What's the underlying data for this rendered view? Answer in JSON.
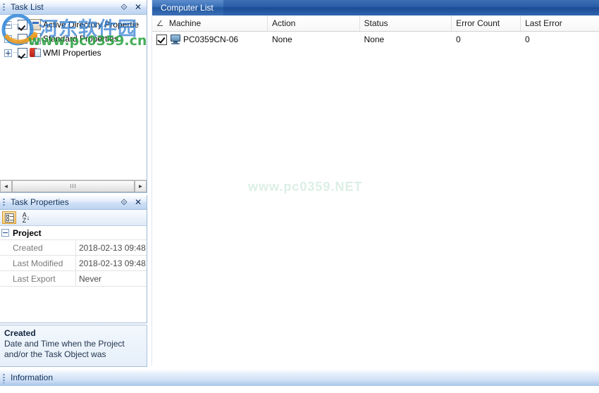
{
  "task_list": {
    "title": "Task List",
    "pin_icon": "pin-icon",
    "close_icon": "close-icon",
    "pin_glyph": "⟐",
    "close_glyph": "✕",
    "items": [
      {
        "label": "Active Directory Propertie",
        "checked": true,
        "expander": "minus",
        "icon": "active-directory-icon"
      },
      {
        "label": "Standard Properties",
        "checked": true,
        "expander": "plus",
        "icon": "standard-properties-icon"
      },
      {
        "label": "WMI Properties",
        "checked": true,
        "expander": "plus",
        "icon": "wmi-properties-icon"
      }
    ],
    "scrollbar": {
      "left_arrow": "◄",
      "right_arrow": "►",
      "thumb_grip": "III"
    }
  },
  "task_properties": {
    "title": "Task Properties",
    "pin_glyph": "⟐",
    "close_glyph": "✕",
    "toolbar": {
      "categorized_label": "Categorized",
      "alphabetical_label": "Alphabetical",
      "az_top": "A",
      "az_bottom": "Z",
      "az_arrow": "↓"
    },
    "category": "Project",
    "rows": [
      {
        "name": "Created",
        "value": "2018-02-13 09:48"
      },
      {
        "name": "Last Modified",
        "value": "2018-02-13 09:48"
      },
      {
        "name": "Last Export",
        "value": "Never"
      }
    ],
    "help": {
      "title": "Created",
      "body": "Date and Time when the Project and/or the Task Object was"
    }
  },
  "information_bar": {
    "title": "Information"
  },
  "document_pane": {
    "tabs": [
      {
        "label": "Computer List",
        "active": true
      }
    ],
    "columns": [
      {
        "key": "machine",
        "label": "Machine",
        "sorted": true
      },
      {
        "key": "action",
        "label": "Action",
        "sorted": false
      },
      {
        "key": "status",
        "label": "Status",
        "sorted": false
      },
      {
        "key": "errorcount",
        "label": "Error Count",
        "sorted": false
      },
      {
        "key": "lasterror",
        "label": "Last Error",
        "sorted": false
      }
    ],
    "sort_glyph": "∠",
    "rows": [
      {
        "checked": true,
        "machine": "PC0359CN-06",
        "action": "None",
        "status": "None",
        "errorcount": "0",
        "lasterror": "0"
      }
    ]
  },
  "watermarks": {
    "site_cn": "河东软件园",
    "site_url": "www.pc0359.cn",
    "center": "www.pc0359.NET"
  },
  "colors": {
    "tab_blue": "#24579f",
    "caption_blue": "#12335c",
    "panel_border": "#9db7d6",
    "watermark_green": "#26a03c",
    "watermark_blue": "#2978ce"
  }
}
